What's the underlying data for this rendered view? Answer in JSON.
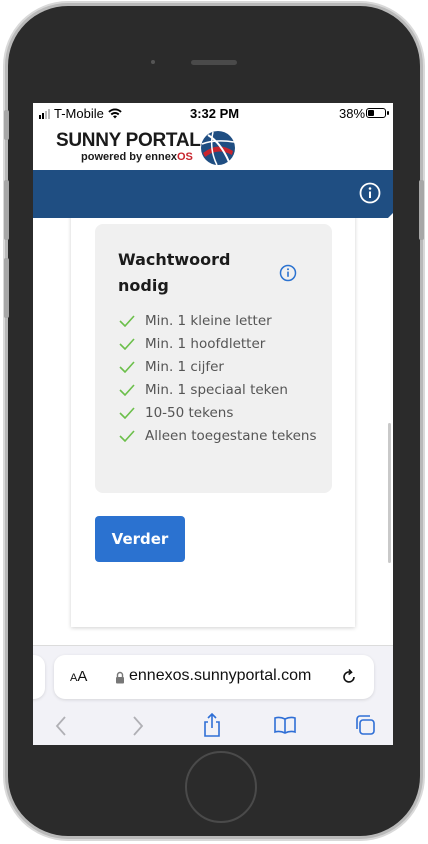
{
  "status_bar": {
    "carrier": "T-Mobile",
    "time": "3:32 PM",
    "battery": "38%"
  },
  "header": {
    "logo_title": "SUNNY PORTAL",
    "logo_sub_prefix": "powered by ennex",
    "logo_sub_suffix": "OS"
  },
  "nav": {
    "info_icon": "info-circle-icon"
  },
  "password_panel": {
    "title": "Wachtwoord nodig",
    "rules": [
      "Min. 1 kleine letter",
      "Min. 1 hoofdletter",
      "Min. 1 cijfer",
      "Min. 1 speciaal teken",
      "10-50 tekens",
      "Alleen toegestane tekens"
    ]
  },
  "actions": {
    "next_label": "Verder"
  },
  "browser": {
    "text_size_label_small": "A",
    "text_size_label_large": "A",
    "url": "ennexos.sunnyportal.com"
  },
  "colors": {
    "nav_bg": "#1f4e82",
    "button_bg": "#2b72d0",
    "check": "#6bbf4a",
    "info": "#2b72d0",
    "brand_red": "#c8242d"
  }
}
